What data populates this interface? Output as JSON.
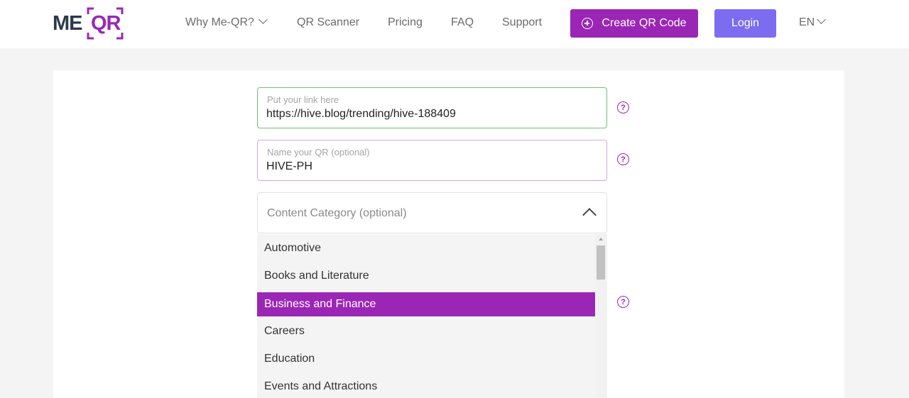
{
  "header": {
    "logo": {
      "part1": "ME",
      "part2": "QR"
    },
    "nav": [
      {
        "label": "Why Me-QR?",
        "has_dropdown": true
      },
      {
        "label": "QR Scanner"
      },
      {
        "label": "Pricing"
      },
      {
        "label": "FAQ"
      },
      {
        "label": "Support"
      }
    ],
    "create_button": "Create QR Code",
    "login_button": "Login",
    "language": "EN"
  },
  "form": {
    "link_field": {
      "label": "Put your link here",
      "value": "https://hive.blog/trending/hive-188409"
    },
    "name_field": {
      "label": "Name your QR (optional)",
      "value": "HIVE-PH"
    },
    "category_select": {
      "placeholder": "Content Category (optional)",
      "expanded": true,
      "options": [
        "Automotive",
        "Books and Literature",
        "Business and Finance",
        "Careers",
        "Education",
        "Events and Attractions"
      ],
      "highlighted": "Business and Finance"
    },
    "help_icon_text": "?"
  },
  "colors": {
    "brand_purple": "#9b26b6",
    "login_violet": "#7b6cf0",
    "logo_dark": "#2d3a4d",
    "valid_border": "#6fc36b"
  },
  "icons": [
    "chevron-down-icon",
    "plus-circle-icon",
    "help-icon",
    "chevron-up-icon"
  ]
}
